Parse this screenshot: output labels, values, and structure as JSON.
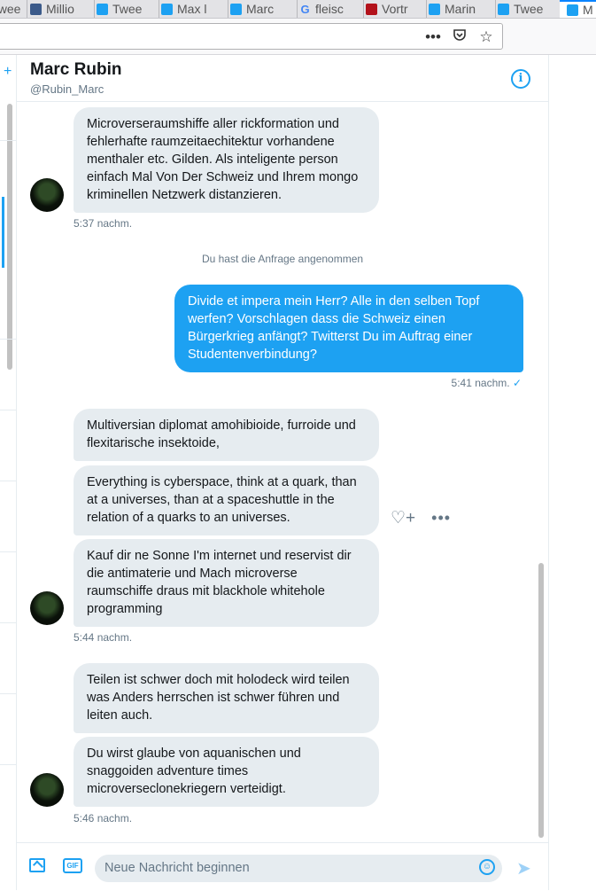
{
  "browser": {
    "tabs": [
      {
        "label": "Twee",
        "icon": "twitter-icon"
      },
      {
        "label": "Millio",
        "icon": "news-icon"
      },
      {
        "label": "Twee",
        "icon": "twitter-icon"
      },
      {
        "label": "Max l",
        "icon": "twitter-icon"
      },
      {
        "label": "Marc",
        "icon": "twitter-icon"
      },
      {
        "label": "fleisc",
        "icon": "google-icon"
      },
      {
        "label": "Vortr",
        "icon": "wk-icon"
      },
      {
        "label": "Marin",
        "icon": "twitter-icon"
      },
      {
        "label": "Twee",
        "icon": "twitter-icon"
      },
      {
        "label": "M",
        "icon": "twitter-icon"
      }
    ],
    "url_actions": [
      "•••",
      "⬚",
      "☆"
    ]
  },
  "header": {
    "name": "Marc Rubin",
    "handle": "@Rubin_Marc",
    "info_icon": "i"
  },
  "messages": {
    "m1": {
      "text": "Microverseraumshiffe aller rickformation und fehlerhafte raumzeitaechitektur vorhandene menthaler etc. Gilden. Als inteligente person einfach Mal Von Der Schweiz und Ihrem mongo kriminellen Netzwerk distanzieren.",
      "time": "5:37 nachm."
    },
    "system": "Du hast die Anfrage angenommen",
    "m2": {
      "text": "Divide et impera mein Herr? Alle in den selben Topf werfen? Vorschlagen dass die Schweiz einen Bürgerkrieg anfängt? Twitterst Du im Auftrag einer Studentenverbindung?",
      "time": "5:41 nachm.",
      "check": "✓"
    },
    "m3": {
      "text": "Multiversian diplomat amohibioide, furroide und flexitarische insektoide,"
    },
    "m4": {
      "text": "Everything is cyberspace, think at a quark, than at a universes, than at a spaceshuttle in the relation of a quarks to an universes."
    },
    "m5": {
      "text": "Kauf dir ne Sonne I'm internet und reservist dir die antimaterie und Mach microverse raumschiffe draus mit blackhole whitehole programming",
      "time": "5:44 nachm."
    },
    "m6": {
      "text": "Teilen ist schwer doch mit holodeck wird teilen was Anders herrschen ist schwer führen und leiten auch."
    },
    "m7": {
      "text": "Du wirst glaube von aquanischen und snaggoiden adventure times microverseclonekriegern verteidigt.",
      "time": "5:46 nachm."
    }
  },
  "hover_actions": {
    "like_icon": "♡+",
    "more_icon": "•••"
  },
  "composer": {
    "placeholder": "Neue Nachricht beginnen",
    "gif_label": "GIF",
    "send_icon": "➤",
    "emoji_icon": "☺"
  },
  "colors": {
    "accent": "#1da1f2",
    "bubble_in": "#e6ecf0",
    "muted": "#657786"
  }
}
